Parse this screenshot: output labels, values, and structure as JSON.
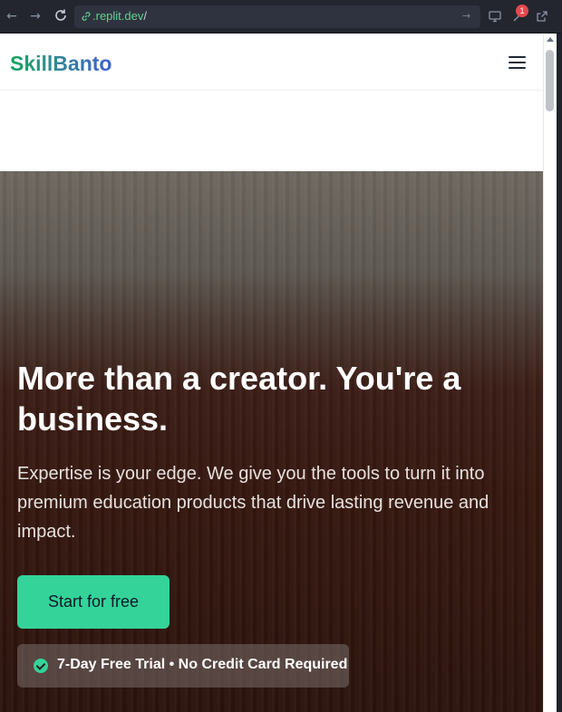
{
  "browser": {
    "url_prefix": ".replit.dev",
    "url_suffix": "/",
    "badge_count": "1"
  },
  "site": {
    "logo": "SkillBanto",
    "menu_icon": "hamburger-menu-icon"
  },
  "hero": {
    "title": "More than a creator. You're a business.",
    "subtitle": "Expertise is your edge. We give you the tools to turn it into premium education products that drive lasting revenue and impact.",
    "cta_label": "Start for free",
    "trial_text": "7-Day Free Trial • No Credit Card Required"
  },
  "colors": {
    "accent": "#34d399",
    "hero_bg": "#34170f"
  }
}
